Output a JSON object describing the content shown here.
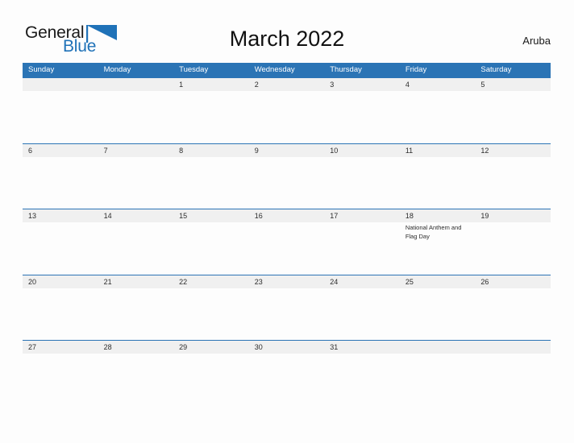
{
  "logo": {
    "text_primary": "General",
    "text_secondary": "Blue",
    "flag_icon": "blue-flag-triangle",
    "primary_color": "#1a1a1a",
    "secondary_color": "#1f72b8"
  },
  "header": {
    "title": "March 2022",
    "region": "Aruba"
  },
  "colors": {
    "header_blue": "#2b74b5",
    "date_band_gray": "#f0f0f0",
    "page_background": "#fdfdfd",
    "text_dark": "#2c2c2c"
  },
  "calendar": {
    "weekdays": [
      "Sunday",
      "Monday",
      "Tuesday",
      "Wednesday",
      "Thursday",
      "Friday",
      "Saturday"
    ],
    "weeks": [
      [
        {
          "date": "",
          "event": ""
        },
        {
          "date": "",
          "event": ""
        },
        {
          "date": "1",
          "event": ""
        },
        {
          "date": "2",
          "event": ""
        },
        {
          "date": "3",
          "event": ""
        },
        {
          "date": "4",
          "event": ""
        },
        {
          "date": "5",
          "event": ""
        }
      ],
      [
        {
          "date": "6",
          "event": ""
        },
        {
          "date": "7",
          "event": ""
        },
        {
          "date": "8",
          "event": ""
        },
        {
          "date": "9",
          "event": ""
        },
        {
          "date": "10",
          "event": ""
        },
        {
          "date": "11",
          "event": ""
        },
        {
          "date": "12",
          "event": ""
        }
      ],
      [
        {
          "date": "13",
          "event": ""
        },
        {
          "date": "14",
          "event": ""
        },
        {
          "date": "15",
          "event": ""
        },
        {
          "date": "16",
          "event": ""
        },
        {
          "date": "17",
          "event": ""
        },
        {
          "date": "18",
          "event": "National Anthem and Flag Day"
        },
        {
          "date": "19",
          "event": ""
        }
      ],
      [
        {
          "date": "20",
          "event": ""
        },
        {
          "date": "21",
          "event": ""
        },
        {
          "date": "22",
          "event": ""
        },
        {
          "date": "23",
          "event": ""
        },
        {
          "date": "24",
          "event": ""
        },
        {
          "date": "25",
          "event": ""
        },
        {
          "date": "26",
          "event": ""
        }
      ],
      [
        {
          "date": "27",
          "event": ""
        },
        {
          "date": "28",
          "event": ""
        },
        {
          "date": "29",
          "event": ""
        },
        {
          "date": "30",
          "event": ""
        },
        {
          "date": "31",
          "event": ""
        },
        {
          "date": "",
          "event": ""
        },
        {
          "date": "",
          "event": ""
        }
      ]
    ]
  }
}
